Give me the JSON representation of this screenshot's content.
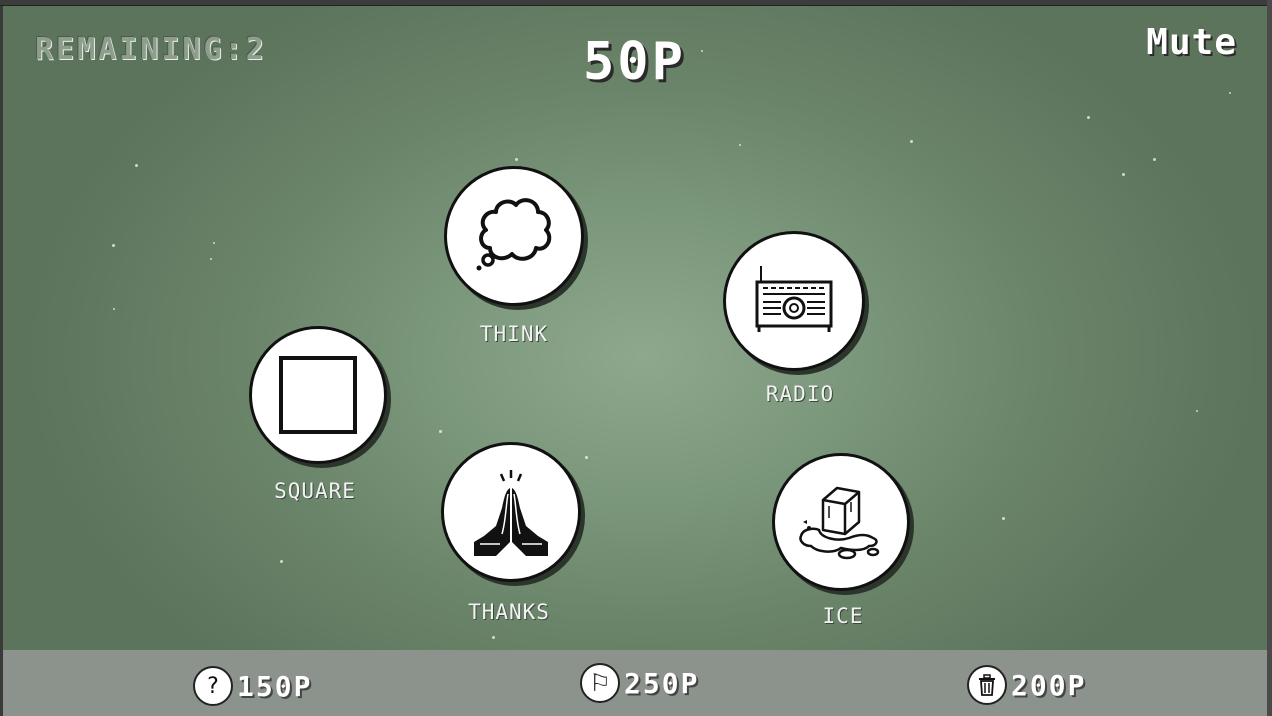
{
  "hud": {
    "remaining": "REMAINING:2",
    "points": "50P",
    "mute": "Mute"
  },
  "tokens": [
    {
      "id": "think",
      "label": "THINK",
      "icon": "thought-bubble-icon"
    },
    {
      "id": "radio",
      "label": "RADIO",
      "icon": "radio-icon"
    },
    {
      "id": "square",
      "label": "SQUARE",
      "icon": "square-icon"
    },
    {
      "id": "thanks",
      "label": "THANKS",
      "icon": "praying-hands-icon"
    },
    {
      "id": "ice",
      "label": "ICE",
      "icon": "melting-ice-cube-icon"
    }
  ],
  "powerups": [
    {
      "id": "hint",
      "icon": "question-icon",
      "glyph": "?",
      "cost": "150P"
    },
    {
      "id": "flag",
      "icon": "flag-icon",
      "glyph": "⚐",
      "cost": "250P"
    },
    {
      "id": "trash",
      "icon": "trash-icon",
      "glyph": "🗑",
      "cost": "200P"
    }
  ],
  "colors": {
    "background": "#7a967b",
    "bottom_bar": "#8c928c",
    "token_fill": "#ffffff",
    "token_border": "#111111",
    "text": "#ffffff"
  }
}
